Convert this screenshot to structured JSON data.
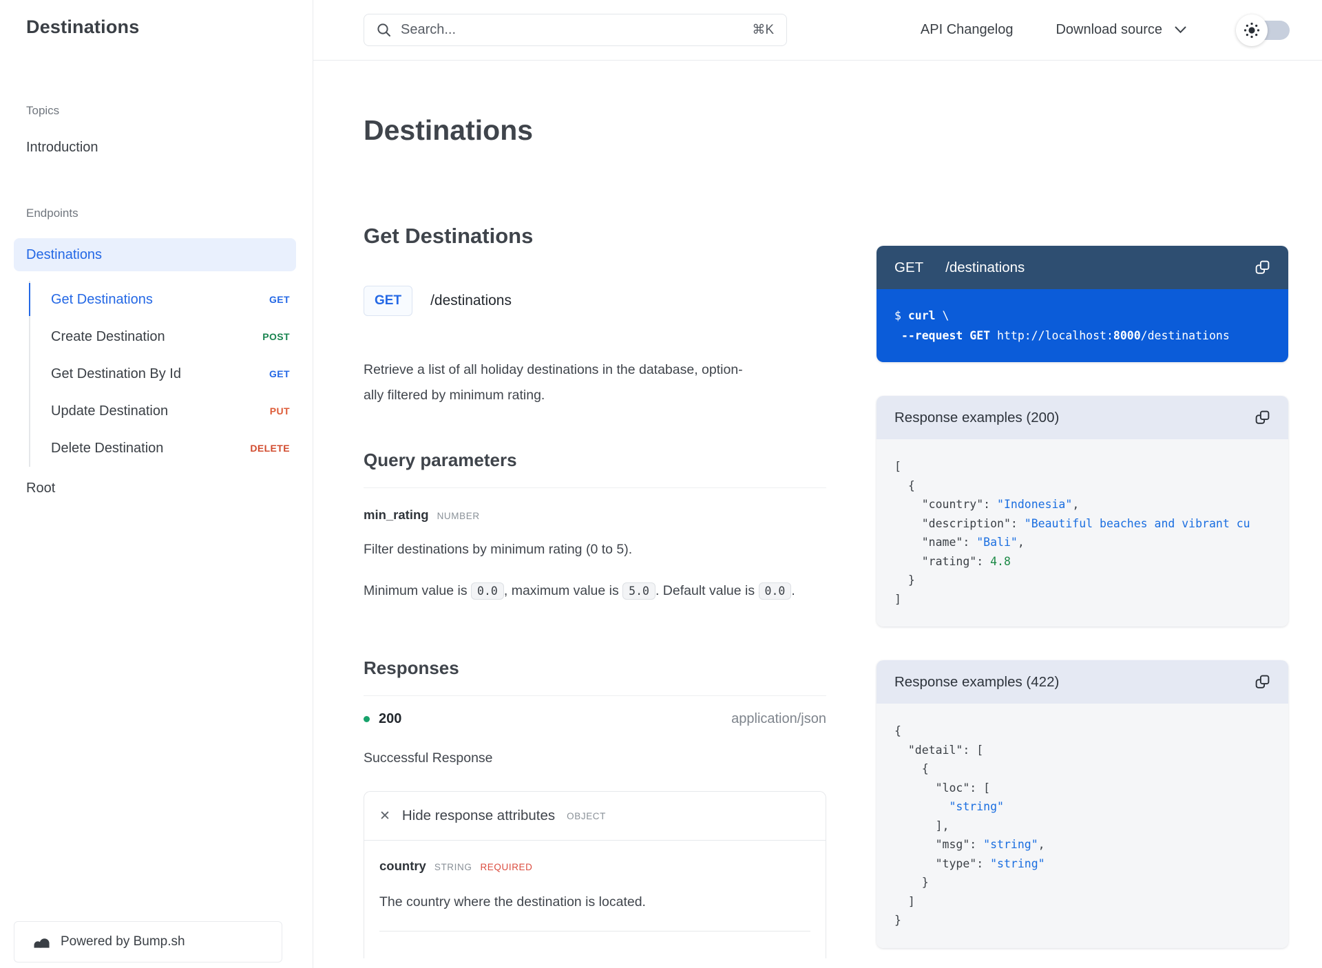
{
  "sidebar": {
    "title": "Destinations",
    "topics_label": "Topics",
    "introduction": "Introduction",
    "endpoints_label": "Endpoints",
    "group": "Destinations",
    "operations": [
      {
        "label": "Get Destinations",
        "method": "GET"
      },
      {
        "label": "Create Destination",
        "method": "POST"
      },
      {
        "label": "Get Destination By Id",
        "method": "GET"
      },
      {
        "label": "Update Destination",
        "method": "PUT"
      },
      {
        "label": "Delete Destination",
        "method": "DELETE"
      }
    ],
    "root": "Root",
    "powered_by": "Powered by Bump.sh"
  },
  "topbar": {
    "search_placeholder": "Search...",
    "shortcut": "⌘K",
    "changelog": "API Changelog",
    "download": "Download source"
  },
  "main": {
    "page_title": "Destinations",
    "op_heading": "Get Destinations",
    "method": "GET",
    "path": "/destinations",
    "desc_line1": "Retrieve a list of all holiday destinations in the database, option-",
    "desc_line2": "ally filtered by minimum rating.",
    "qp_heading": "Query parameters",
    "param_name": "min_rating",
    "param_type": "NUMBER",
    "param_desc": "Filter destinations by minimum rating (0 to 5).",
    "constraint_pre": "Minimum value is ",
    "chip_min": "0.0",
    "constraint_mid1": ", maximum value is ",
    "chip_max": "5.0",
    "constraint_mid2": ". Default value is ",
    "chip_default": "0.0",
    "constraint_end": ".",
    "resp_heading": "Responses",
    "status": "200",
    "content_type": "application/json",
    "resp_desc": "Successful Response",
    "toggle_label": "Hide response attributes",
    "toggle_kind": "OBJECT",
    "attr_name": "country",
    "attr_type": "STRING",
    "attr_required": "REQUIRED",
    "attr_desc": "The country where the destination is located."
  },
  "rail": {
    "request": {
      "method": "GET",
      "path": "/destinations",
      "lines": [
        [
          [
            "$ ",
            "p"
          ],
          [
            "curl",
            "b"
          ],
          [
            " \\",
            "p"
          ]
        ],
        [
          [
            " ",
            "p"
          ],
          [
            "--request GET",
            "b"
          ],
          [
            " http://localhost:",
            "p"
          ],
          [
            "8000",
            "b"
          ],
          [
            "/destinations",
            "p"
          ]
        ]
      ]
    },
    "r200": {
      "title": "Response examples (200)",
      "lines": [
        [
          [
            "[",
            "p"
          ]
        ],
        [
          [
            "  {",
            "p"
          ]
        ],
        [
          [
            "    ",
            "p"
          ],
          [
            "\"country\"",
            "k"
          ],
          [
            ": ",
            "p"
          ],
          [
            "\"Indonesia\"",
            "s"
          ],
          [
            ",",
            "p"
          ]
        ],
        [
          [
            "    ",
            "p"
          ],
          [
            "\"description\"",
            "k"
          ],
          [
            ": ",
            "p"
          ],
          [
            "\"Beautiful beaches and vibrant cu",
            "s"
          ]
        ],
        [
          [
            "    ",
            "p"
          ],
          [
            "\"name\"",
            "k"
          ],
          [
            ": ",
            "p"
          ],
          [
            "\"Bali\"",
            "s"
          ],
          [
            ",",
            "p"
          ]
        ],
        [
          [
            "    ",
            "p"
          ],
          [
            "\"rating\"",
            "k"
          ],
          [
            ": ",
            "p"
          ],
          [
            "4.8",
            "n"
          ]
        ],
        [
          [
            "  }",
            "p"
          ]
        ],
        [
          [
            "]",
            "p"
          ]
        ]
      ]
    },
    "r422": {
      "title": "Response examples (422)",
      "lines": [
        [
          [
            "{",
            "p"
          ]
        ],
        [
          [
            "  ",
            "p"
          ],
          [
            "\"detail\"",
            "k"
          ],
          [
            ": [",
            "p"
          ]
        ],
        [
          [
            "    {",
            "p"
          ]
        ],
        [
          [
            "      ",
            "p"
          ],
          [
            "\"loc\"",
            "k"
          ],
          [
            ": [",
            "p"
          ]
        ],
        [
          [
            "        ",
            "p"
          ],
          [
            "\"string\"",
            "s"
          ]
        ],
        [
          [
            "      ],",
            "p"
          ]
        ],
        [
          [
            "      ",
            "p"
          ],
          [
            "\"msg\"",
            "k"
          ],
          [
            ": ",
            "p"
          ],
          [
            "\"string\"",
            "s"
          ],
          [
            ",",
            "p"
          ]
        ],
        [
          [
            "      ",
            "p"
          ],
          [
            "\"type\"",
            "k"
          ],
          [
            ": ",
            "p"
          ],
          [
            "\"string\"",
            "s"
          ]
        ],
        [
          [
            "    }",
            "p"
          ]
        ],
        [
          [
            "  ]",
            "p"
          ]
        ],
        [
          [
            "}",
            "p"
          ]
        ]
      ]
    }
  },
  "colors": {
    "accent": "#2468E5",
    "method_get": "#2468E5",
    "method_post": "#1A8450",
    "method_put": "#DD5B37",
    "method_delete": "#D14B2E",
    "status_dot": "#17A26B",
    "required": "#DB4C3F",
    "curl_header_bg": "#2E4E71",
    "curl_body_bg": "#0B5CD9",
    "json_string": "#1A6EE0",
    "json_number": "#1D8A47",
    "active_item_bg": "#E9F0FD"
  }
}
